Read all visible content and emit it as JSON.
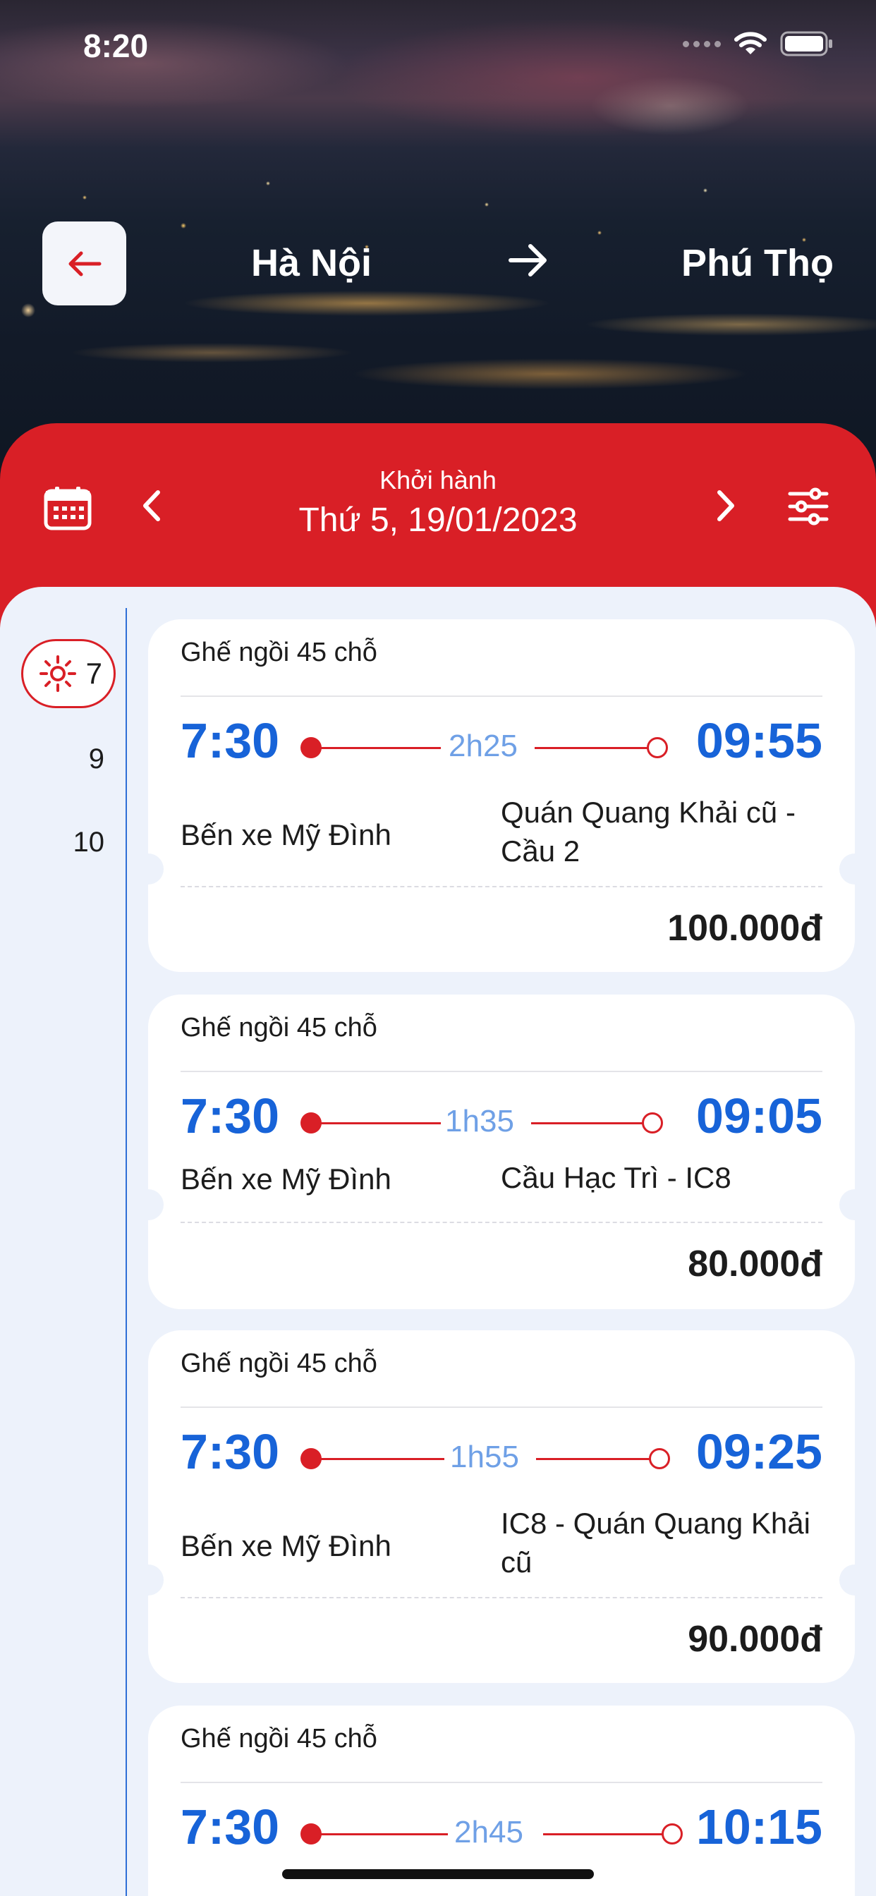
{
  "status": {
    "time": "8:20"
  },
  "header": {
    "from": "Hà Nội",
    "to": "Phú Thọ"
  },
  "date_bar": {
    "label": "Khởi hành",
    "date": "Thứ 5, 19/01/2023"
  },
  "hours": {
    "active": "7",
    "others": [
      "9",
      "10"
    ]
  },
  "trips": [
    {
      "seat_type": "Ghế ngồi 45 chỗ",
      "depart": "7:30",
      "duration": "2h25",
      "arrive": "09:55",
      "from": "Bến xe Mỹ Đình",
      "to": "Quán Quang Khải cũ - Cầu 2",
      "price": "100.000đ"
    },
    {
      "seat_type": "Ghế ngồi 45 chỗ",
      "depart": "7:30",
      "duration": "1h35",
      "arrive": "09:05",
      "from": "Bến xe Mỹ Đình",
      "to": "Cầu Hạc Trì - IC8",
      "price": "80.000đ"
    },
    {
      "seat_type": "Ghế ngồi 45 chỗ",
      "depart": "7:30",
      "duration": "1h55",
      "arrive": "09:25",
      "from": "Bến xe Mỹ Đình",
      "to": "IC8 - Quán Quang Khải cũ",
      "price": "90.000đ"
    },
    {
      "seat_type": "Ghế ngồi 45 chỗ",
      "depart": "7:30",
      "duration": "2h45",
      "arrive": "10:15",
      "from": "",
      "to": "",
      "price": ""
    }
  ],
  "colors": {
    "brand_red": "#d91f26",
    "time_blue": "#1763d8",
    "duration_blue": "#6fa0e6",
    "background": "#edf2fb"
  },
  "icons": [
    "back-arrow-icon",
    "route-arrow-icon",
    "calendar-icon",
    "chevron-left-icon",
    "chevron-right-icon",
    "filter-icon",
    "sun-icon",
    "wifi-icon",
    "battery-icon"
  ]
}
